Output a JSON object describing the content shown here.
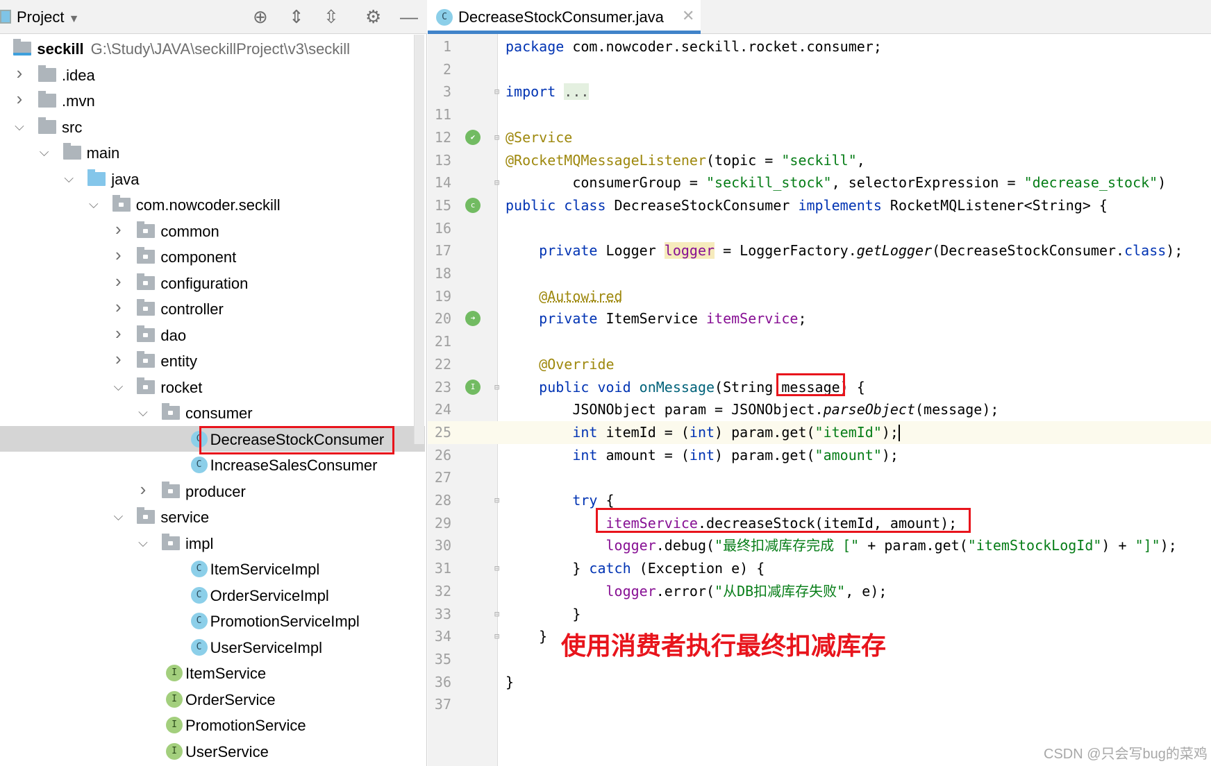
{
  "project_panel": {
    "title": "Project",
    "toolbar_icons": [
      "locate-icon",
      "expand-all-icon",
      "collapse-all-icon",
      "gear-icon",
      "minimize-icon"
    ],
    "tree": [
      {
        "label": "seckill",
        "path": "G:\\Study\\JAVA\\seckillProject\\v3\\seckill",
        "level": 0,
        "type": "module",
        "state": "expanded"
      },
      {
        "label": ".idea",
        "level": 1,
        "type": "folder",
        "state": "collapsed"
      },
      {
        "label": ".mvn",
        "level": 1,
        "type": "folder",
        "state": "collapsed"
      },
      {
        "label": "src",
        "level": 1,
        "type": "folder",
        "state": "expanded"
      },
      {
        "label": "main",
        "level": 2,
        "type": "folder",
        "state": "expanded"
      },
      {
        "label": "java",
        "level": 3,
        "type": "source-folder",
        "state": "expanded"
      },
      {
        "label": "com.nowcoder.seckill",
        "level": 4,
        "type": "package",
        "state": "expanded"
      },
      {
        "label": "common",
        "level": 5,
        "type": "package",
        "state": "collapsed"
      },
      {
        "label": "component",
        "level": 5,
        "type": "package",
        "state": "collapsed"
      },
      {
        "label": "configuration",
        "level": 5,
        "type": "package",
        "state": "collapsed"
      },
      {
        "label": "controller",
        "level": 5,
        "type": "package",
        "state": "collapsed"
      },
      {
        "label": "dao",
        "level": 5,
        "type": "package",
        "state": "collapsed"
      },
      {
        "label": "entity",
        "level": 5,
        "type": "package",
        "state": "collapsed"
      },
      {
        "label": "rocket",
        "level": 5,
        "type": "package",
        "state": "expanded"
      },
      {
        "label": "consumer",
        "level": 6,
        "type": "package",
        "state": "expanded"
      },
      {
        "label": "DecreaseStockConsumer",
        "level": 7,
        "type": "class",
        "selected": true
      },
      {
        "label": "IncreaseSalesConsumer",
        "level": 7,
        "type": "class"
      },
      {
        "label": "producer",
        "level": 6,
        "type": "package",
        "state": "collapsed"
      },
      {
        "label": "service",
        "level": 5,
        "type": "package",
        "state": "expanded"
      },
      {
        "label": "impl",
        "level": 6,
        "type": "package",
        "state": "expanded"
      },
      {
        "label": "ItemServiceImpl",
        "level": 7,
        "type": "class"
      },
      {
        "label": "OrderServiceImpl",
        "level": 7,
        "type": "class"
      },
      {
        "label": "PromotionServiceImpl",
        "level": 7,
        "type": "class"
      },
      {
        "label": "UserServiceImpl",
        "level": 7,
        "type": "class"
      },
      {
        "label": "ItemService",
        "level": 6,
        "type": "interface"
      },
      {
        "label": "OrderService",
        "level": 6,
        "type": "interface"
      },
      {
        "label": "PromotionService",
        "level": 6,
        "type": "interface"
      },
      {
        "label": "UserService",
        "level": 6,
        "type": "interface"
      }
    ]
  },
  "editor": {
    "tab": {
      "label": "DecreaseStockConsumer.java",
      "icon_letter": "C"
    },
    "current_line": 25,
    "lines": [
      {
        "n": "1",
        "t": [
          [
            "package",
            "k"
          ],
          [
            " com.nowcoder.seckill.rocket.consumer;",
            ""
          ]
        ]
      },
      {
        "n": "2",
        "t": []
      },
      {
        "n": "3",
        "t": [
          [
            "import",
            "k"
          ],
          [
            " ",
            ""
          ],
          [
            "...",
            "fold"
          ]
        ],
        "fold": true
      },
      {
        "n": "11",
        "t": []
      },
      {
        "n": "12",
        "t": [
          [
            "@Service",
            "a"
          ]
        ],
        "gicon": "bean-check-icon",
        "fold": true
      },
      {
        "n": "13",
        "t": [
          [
            "@RocketMQMessageListener",
            "a"
          ],
          [
            "(topic = ",
            ""
          ],
          [
            "\"seckill\"",
            "s"
          ],
          [
            ",",
            ""
          ]
        ]
      },
      {
        "n": "14",
        "t": [
          [
            "        consumerGroup = ",
            ""
          ],
          [
            "\"seckill_stock\"",
            "s"
          ],
          [
            ", selectorExpression = ",
            ""
          ],
          [
            "\"decrease_stock\"",
            "s"
          ],
          [
            ")",
            ""
          ]
        ],
        "fold": true
      },
      {
        "n": "15",
        "t": [
          [
            "public class ",
            "k"
          ],
          [
            "DecreaseStockConsumer ",
            ""
          ],
          [
            "implements ",
            "k"
          ],
          [
            "RocketMQListener<String> {",
            ""
          ]
        ],
        "gicon": "bean-class-icon"
      },
      {
        "n": "16",
        "t": []
      },
      {
        "n": "17",
        "t": [
          [
            "    ",
            ""
          ],
          [
            "private ",
            "k"
          ],
          [
            "Logger ",
            ""
          ],
          [
            "logger",
            "f h"
          ],
          [
            " = LoggerFactory.",
            ""
          ],
          [
            "getLogger",
            "i"
          ],
          [
            "(DecreaseStockConsumer.",
            ""
          ],
          [
            "class",
            "k"
          ],
          [
            ");",
            ""
          ]
        ]
      },
      {
        "n": "18",
        "t": []
      },
      {
        "n": "19",
        "t": [
          [
            "    ",
            ""
          ],
          [
            "@Autowired",
            "a u"
          ]
        ]
      },
      {
        "n": "20",
        "t": [
          [
            "    ",
            ""
          ],
          [
            "private ",
            "k"
          ],
          [
            "ItemService ",
            ""
          ],
          [
            "itemService",
            "f"
          ],
          [
            ";",
            ""
          ]
        ],
        "gicon": "autowired-icon"
      },
      {
        "n": "21",
        "t": []
      },
      {
        "n": "22",
        "t": [
          [
            "    ",
            ""
          ],
          [
            "@Override",
            "a"
          ]
        ]
      },
      {
        "n": "23",
        "t": [
          [
            "    ",
            ""
          ],
          [
            "public void ",
            "k"
          ],
          [
            "onMessage",
            "m"
          ],
          [
            "(String ",
            ""
          ],
          [
            "message",
            ""
          ],
          [
            ") {",
            ""
          ]
        ],
        "gicon": "implements-method-icon",
        "fold": true
      },
      {
        "n": "24",
        "t": [
          [
            "        JSONObject param = JSONObject.",
            ""
          ],
          [
            "parseObject",
            "i"
          ],
          [
            "(message);",
            ""
          ]
        ]
      },
      {
        "n": "25",
        "t": [
          [
            "        ",
            ""
          ],
          [
            "int ",
            "k"
          ],
          [
            "itemId = (",
            ""
          ],
          [
            "int",
            "k"
          ],
          [
            ") param.get(",
            ""
          ],
          [
            "\"itemId\"",
            "s"
          ],
          [
            ");",
            ""
          ]
        ]
      },
      {
        "n": "26",
        "t": [
          [
            "        ",
            ""
          ],
          [
            "int ",
            "k"
          ],
          [
            "amount = (",
            ""
          ],
          [
            "int",
            "k"
          ],
          [
            ") param.get(",
            ""
          ],
          [
            "\"amount\"",
            "s"
          ],
          [
            ");",
            ""
          ]
        ]
      },
      {
        "n": "27",
        "t": []
      },
      {
        "n": "28",
        "t": [
          [
            "        ",
            ""
          ],
          [
            "try ",
            "k"
          ],
          [
            "{",
            ""
          ]
        ],
        "fold": true
      },
      {
        "n": "29",
        "t": [
          [
            "            ",
            ""
          ],
          [
            "itemService",
            "f"
          ],
          [
            ".decreaseStock(itemId, amount);",
            ""
          ]
        ]
      },
      {
        "n": "30",
        "t": [
          [
            "            ",
            ""
          ],
          [
            "logger",
            "f"
          ],
          [
            ".debug(",
            ""
          ],
          [
            "\"最终扣减库存完成 [\"",
            "s"
          ],
          [
            " + param.get(",
            ""
          ],
          [
            "\"itemStockLogId\"",
            "s"
          ],
          [
            ") + ",
            ""
          ],
          [
            "\"]\"",
            "s"
          ],
          [
            ");",
            ""
          ]
        ]
      },
      {
        "n": "31",
        "t": [
          [
            "        } ",
            ""
          ],
          [
            "catch ",
            "k"
          ],
          [
            "(Exception e) {",
            ""
          ]
        ],
        "fold": true
      },
      {
        "n": "32",
        "t": [
          [
            "            ",
            ""
          ],
          [
            "logger",
            "f"
          ],
          [
            ".error(",
            ""
          ],
          [
            "\"从DB扣减库存失败\"",
            "s"
          ],
          [
            ", e);",
            ""
          ]
        ]
      },
      {
        "n": "33",
        "t": [
          [
            "        }",
            ""
          ]
        ],
        "fold": true
      },
      {
        "n": "34",
        "t": [
          [
            "    }",
            ""
          ]
        ],
        "fold": true
      },
      {
        "n": "35",
        "t": []
      },
      {
        "n": "36",
        "t": [
          [
            "}",
            ""
          ]
        ]
      },
      {
        "n": "37",
        "t": []
      }
    ]
  },
  "annotation": "使用消费者执行最终扣减库存",
  "watermark": "CSDN @只会写bug的菜鸡",
  "colors": {
    "keyword": "#0033b3",
    "string": "#067d17",
    "annotation": "#9e880d",
    "field": "#871094",
    "highlight_box": "#e8141c",
    "tab_underline": "#4083c9"
  }
}
